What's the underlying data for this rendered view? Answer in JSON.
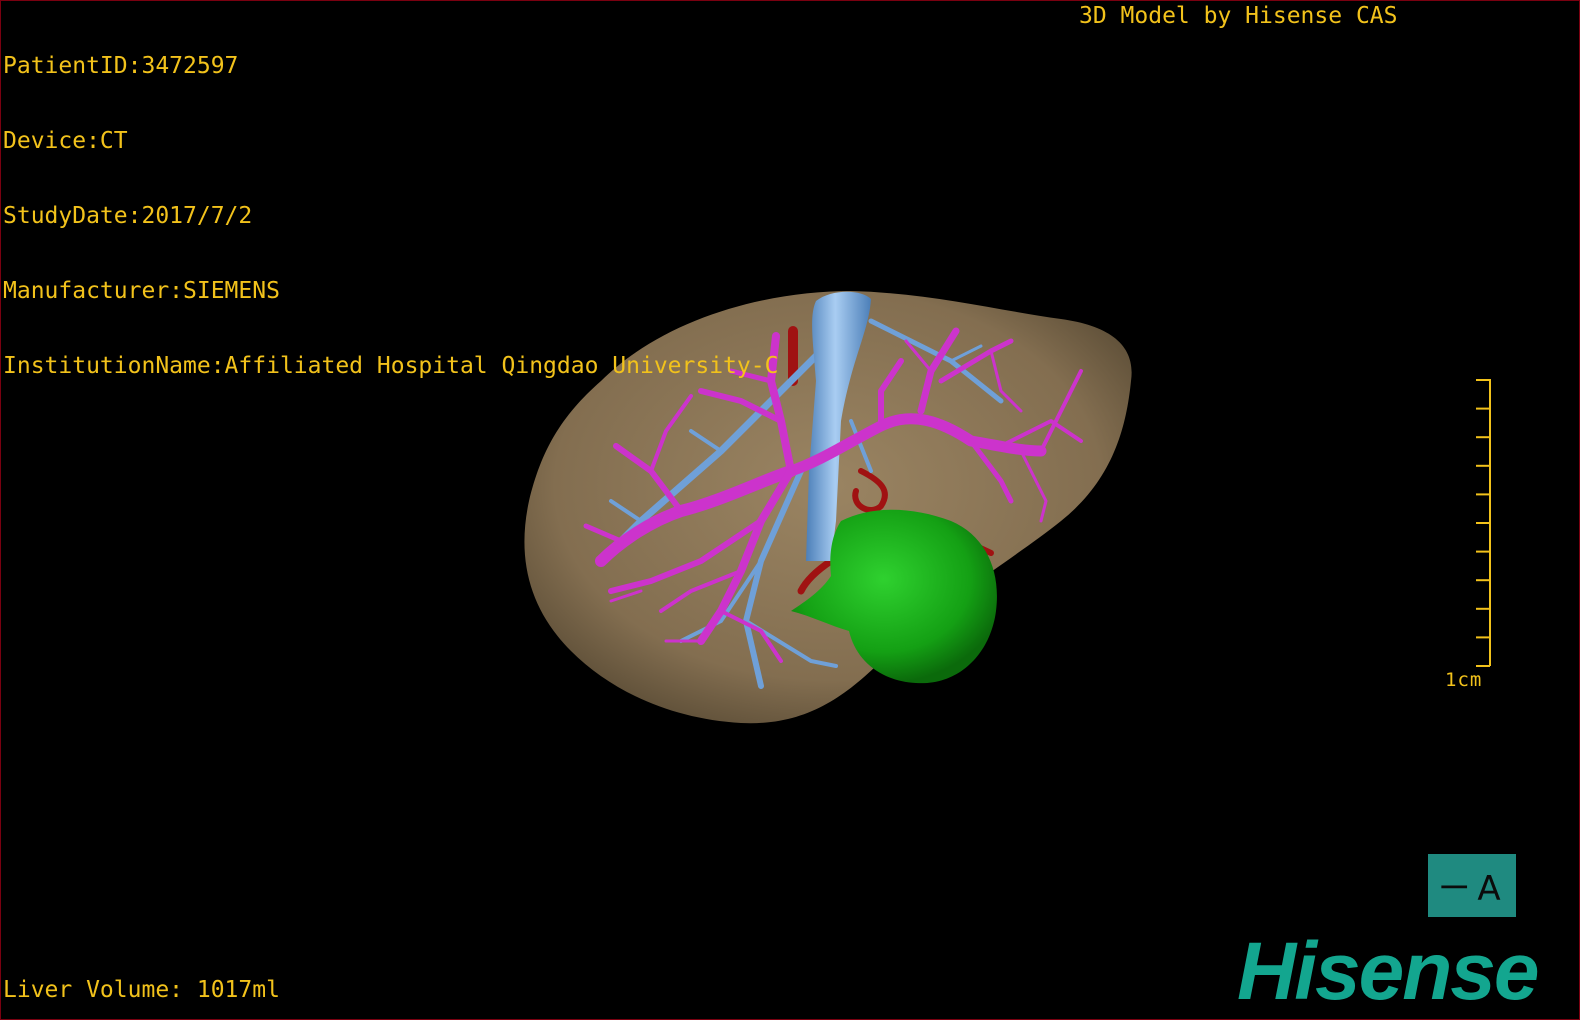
{
  "patient_info": {
    "patient_id": "PatientID:3472597",
    "device": "Device:CT",
    "study_date": "StudyDate:2017/7/2",
    "manufacturer": "Manufacturer:SIEMENS",
    "institution": "InstitutionName:Affiliated Hospital Qingdao University-C"
  },
  "model_credit": "3D Model by Hisense CAS",
  "liver_volume": "Liver Volume: 1017ml",
  "scale_bar": {
    "label": "1cm",
    "tick_count": 10
  },
  "orientation_cube": {
    "label": "ㄧA",
    "icon": "orientation-cube-icon"
  },
  "brand_logo": "Hisense",
  "colors": {
    "overlay_text": "#f2c21b",
    "liver": "#8a7556",
    "portal_vein": "#cc33cc",
    "hepatic_vein": "#6fa0d8",
    "artery": "#a01212",
    "tumor": "#1aa61a",
    "logo": "#13a68f",
    "border": "#7a0010"
  }
}
